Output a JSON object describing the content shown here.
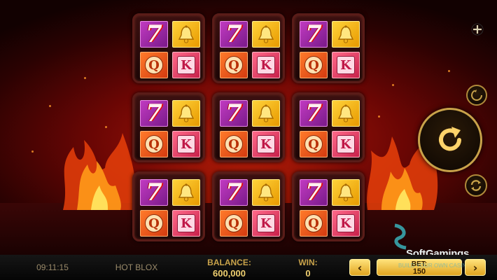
{
  "game": {
    "title": "HOT BLOX",
    "clock": "09:11:15"
  },
  "balance": {
    "label": "BALANCE:",
    "value": "600,000"
  },
  "win": {
    "label": "WIN:",
    "value": "0"
  },
  "bet": {
    "label": "BET:",
    "value": "150",
    "decrease_label": "‹",
    "increase_label": "›"
  },
  "brand": {
    "name": "SoftGamings",
    "tagline": "BUILD YOUR OWN CASINO"
  },
  "blocks": [
    {
      "symbols": [
        "seven",
        "bell",
        "Q",
        "K"
      ]
    },
    {
      "symbols": [
        "seven",
        "bell",
        "Q",
        "K"
      ]
    },
    {
      "symbols": [
        "seven",
        "bell",
        "Q",
        "K"
      ]
    },
    {
      "symbols": [
        "seven",
        "bell",
        "Q",
        "K"
      ]
    },
    {
      "symbols": [
        "seven",
        "bell",
        "Q",
        "K"
      ]
    },
    {
      "symbols": [
        "seven",
        "bell",
        "Q",
        "K"
      ]
    },
    {
      "symbols": [
        "seven",
        "bell",
        "Q",
        "K"
      ]
    },
    {
      "symbols": [
        "seven",
        "bell",
        "Q",
        "K"
      ]
    },
    {
      "symbols": [
        "seven",
        "bell",
        "Q",
        "K"
      ]
    }
  ],
  "symbol_text": {
    "seven": "7",
    "q": "Q",
    "k": "K"
  },
  "controls": {
    "menu_icon": "plus-icon",
    "turbo_icon": "turbo-icon",
    "spin_icon": "spin-arrow-icon",
    "autoplay_icon": "autoplay-icon"
  },
  "colors": {
    "accent_gold": "#c8a24a",
    "seven_tile": "#a02ab0",
    "bell_tile": "#f5b81a",
    "q_tile": "#f05a1a",
    "k_tile": "#e8406a"
  }
}
